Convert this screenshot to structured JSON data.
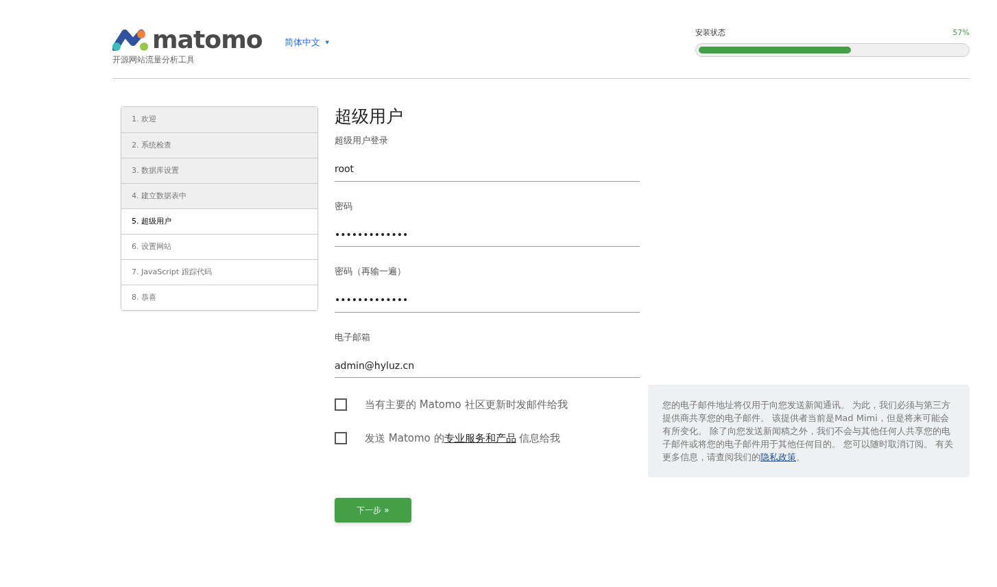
{
  "header": {
    "logo_text": "matomo",
    "tagline": "开源网站流量分析工具",
    "language": "简体中文",
    "language_caret": "▼"
  },
  "progress": {
    "label": "安装状态",
    "reading": "57%",
    "level": 0.57
  },
  "steps": [
    {
      "label": "1. 欢迎",
      "done": true,
      "selected": false
    },
    {
      "label": "2. 系统检查",
      "done": true,
      "selected": false
    },
    {
      "label": "3. 数据库设置",
      "done": true,
      "selected": false
    },
    {
      "label": "4. 建立数据表中",
      "done": true,
      "selected": false
    },
    {
      "label": "5. 超级用户",
      "done": false,
      "selected": true
    },
    {
      "label": "6. 设置网站",
      "done": false,
      "selected": false
    },
    {
      "label": "7. JavaScript 跟踪代码",
      "done": false,
      "selected": false
    },
    {
      "label": "8. 恭喜",
      "done": false,
      "selected": false
    }
  ],
  "form": {
    "title": "超级用户",
    "fields": [
      {
        "label": "超级用户登录",
        "value": "root"
      },
      {
        "label": "密码",
        "value": "•••••••••••••"
      },
      {
        "label": "密码（再输一遍）",
        "value": "•••••••••••••"
      },
      {
        "label": "电子邮箱",
        "value": "admin@hyluz.cn"
      }
    ],
    "checkboxes": [
      {
        "before": "当有主要的 Matomo 社区更新时发邮件给我",
        "checked": false
      },
      {
        "before": "发送 Matomo 的",
        "link": "专业服务和产品",
        "after": " 信息给我",
        "checked": false
      }
    ],
    "note": {
      "before": "您的电子邮件地址将仅用于向您发送新闻通讯。 为此，我们必须与第三方提供商共享您的电子邮件。 该提供者当前是Mad Mimi，但是将来可能会有所变化。 除了向您发送新闻稿之外，我们不会与其他任何人共享您的电子邮件或将您的电子邮件用于其他任何目的。 您可以随时取消订阅。 有关更多信息，请查阅我们的",
      "link": "隐私政策",
      "after": "。"
    },
    "next_button": "下一步 »"
  }
}
